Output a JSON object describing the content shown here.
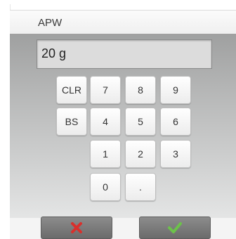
{
  "header": {
    "title": "APW"
  },
  "display": {
    "value": "20 g"
  },
  "keypad": {
    "clr": "CLR",
    "bs": "BS",
    "k7": "7",
    "k8": "8",
    "k9": "9",
    "k4": "4",
    "k5": "5",
    "k6": "6",
    "k1": "1",
    "k2": "2",
    "k3": "3",
    "k0": "0",
    "kdot": "."
  },
  "footer": {
    "cancel_icon": "red-x-icon",
    "confirm_icon": "green-check-icon"
  },
  "colors": {
    "cancel": "#d9302c",
    "confirm": "#6cc24a"
  }
}
